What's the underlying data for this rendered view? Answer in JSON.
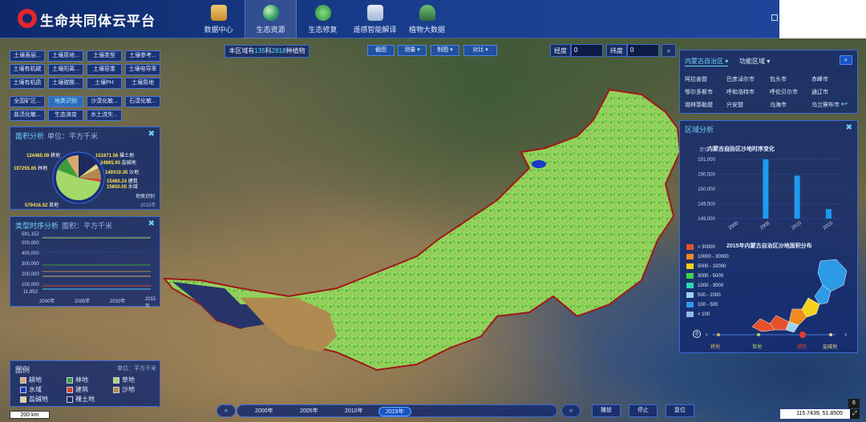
{
  "header": {
    "app_title": "生命共同体云平台",
    "nav": [
      {
        "label": "数据中心",
        "icon": "data-center-icon"
      },
      {
        "label": "生态资源",
        "icon": "eco-resource-icon"
      },
      {
        "label": "生态修复",
        "icon": "eco-restore-icon"
      },
      {
        "label": "遥感智能解译",
        "icon": "remote-sensing-icon"
      },
      {
        "label": "植物大数据",
        "icon": "plant-data-icon"
      }
    ],
    "active_nav": "生态资源"
  },
  "left_buttons": {
    "rows": [
      [
        "土壤表层...",
        "土壤质地...",
        "土壤类型",
        "土壤参考..."
      ],
      [
        "土壤有机碳",
        "土壤阳离...",
        "土壤容重",
        "土壤电导率"
      ],
      [
        "土壤有机质",
        "土壤碳酸...",
        "土壤PH",
        "土壤质地"
      ],
      [
        "全国矿区...",
        "地类识别",
        "沙漠化敏...",
        "石漠化敏..."
      ],
      [
        "盐渍化敏...",
        "生态演变",
        "水土流失..."
      ]
    ],
    "active": "地类识别"
  },
  "area_analysis": {
    "title": "面积分析",
    "unit": "单位：平方千米",
    "labels": [
      {
        "value": "124465.09",
        "name": "耕地"
      },
      {
        "value": "197255.65",
        "name": "林地"
      },
      {
        "value": "579416.52",
        "name": "草地"
      },
      {
        "value": "151671.56",
        "name": "裸土地"
      },
      {
        "value": "24965.95",
        "name": "盐碱地"
      },
      {
        "value": "149319.35",
        "name": "沙地"
      },
      {
        "value": "15460.24",
        "name": "建筑"
      },
      {
        "value": "15650.05",
        "name": "水域"
      }
    ],
    "note": "地类识别",
    "year": "2015年"
  },
  "time_series": {
    "title": "类型时序分析",
    "unit": "面积：平方千米",
    "y_ticks": [
      "581,152",
      "500,000",
      "400,000",
      "300,000",
      "200,000",
      "100,000",
      "11,952"
    ],
    "x_ticks": [
      "2000年",
      "2005年",
      "2010年",
      "2015年"
    ]
  },
  "legend": {
    "title": "图例",
    "unit": "单位：平方千米",
    "items": [
      {
        "name": "耕地",
        "color": "#d8a96a"
      },
      {
        "name": "林地",
        "color": "#3e9b3c"
      },
      {
        "name": "草地",
        "color": "#a4d86a"
      },
      {
        "name": "水域",
        "color": "#1c38c6"
      },
      {
        "name": "建筑",
        "color": "#e23a2c"
      },
      {
        "name": "沙地",
        "color": "#b18a52"
      },
      {
        "name": "盐碱地",
        "color": "#e8d28a"
      },
      {
        "name": "裸土地",
        "color": "#1d2a5a"
      }
    ]
  },
  "toolbar": {
    "stat_prefix": "本区域有",
    "stat_families": "135",
    "stat_mid": "科",
    "stat_species": "2818",
    "stat_suffix": "种植物",
    "buttons": [
      "截图",
      "测量 ▾",
      "制图 ▾",
      "对比 ▾"
    ],
    "lon_label": "经度",
    "lon_value": "0",
    "lat_label": "纬度",
    "lat_value": "0",
    "search_icon": "search-icon"
  },
  "region_panel": {
    "tab_admin": "内蒙古自治区 ▾",
    "tab_func": "功能区域 ▾",
    "cities": [
      [
        "阿拉善盟",
        "巴彦淖尔市",
        "包头市",
        "赤峰市"
      ],
      [
        "鄂尔多斯市",
        "呼和浩特市",
        "呼伦贝尔市",
        "通辽市"
      ],
      [
        "锡林郭勒盟",
        "兴安盟",
        "乌海市",
        "乌兰察布市"
      ]
    ]
  },
  "region_analysis": {
    "title": "区域分析",
    "bar_chart_title": "内蒙古自治区沙地时序变化",
    "unit": "单位：平方公里",
    "map_title": "2015年内蒙古自治区沙地面积分布",
    "map_legend": [
      {
        "label": "> 30000",
        "color": "#e8502a"
      },
      {
        "label": "10000 - 30000",
        "color": "#f08a1e"
      },
      {
        "label": "5000 - 10000",
        "color": "#f7d21a"
      },
      {
        "label": "3000 - 5000",
        "color": "#3fd34a"
      },
      {
        "label": "1000 - 3000",
        "color": "#2ad7b0"
      },
      {
        "label": "500 - 1000",
        "color": "#9ad4f0"
      },
      {
        "label": "100 - 500",
        "color": "#2d9ae8"
      },
      {
        "label": "< 100",
        "color": "#8db9e6"
      }
    ],
    "type_switch": [
      "耕地",
      "草地",
      "建筑",
      "盐碱地"
    ]
  },
  "chart_data": {
    "type": "bar",
    "title": "内蒙古自治区沙地时序变化",
    "categories": [
      "2000",
      "2005",
      "2010",
      "2015"
    ],
    "values": [
      148850,
      151000,
      150450,
      149320
    ],
    "ylim": [
      149000,
      151000
    ],
    "y_ticks": [
      "151,000",
      "150,500",
      "150,000",
      "149,500",
      "149,000"
    ],
    "ylabel": "单位：平方公里",
    "color": "#1e9bf0"
  },
  "timeline": {
    "years": [
      "2000年",
      "2005年",
      "2010年",
      "2015年"
    ],
    "active": "2015年",
    "prev": "«",
    "next": "»",
    "play": "播放",
    "stop": "停止",
    "reset": "复位"
  },
  "status": {
    "scale": "200 km",
    "coords": "115.7439, 51.8505",
    "corner_num": "6"
  }
}
